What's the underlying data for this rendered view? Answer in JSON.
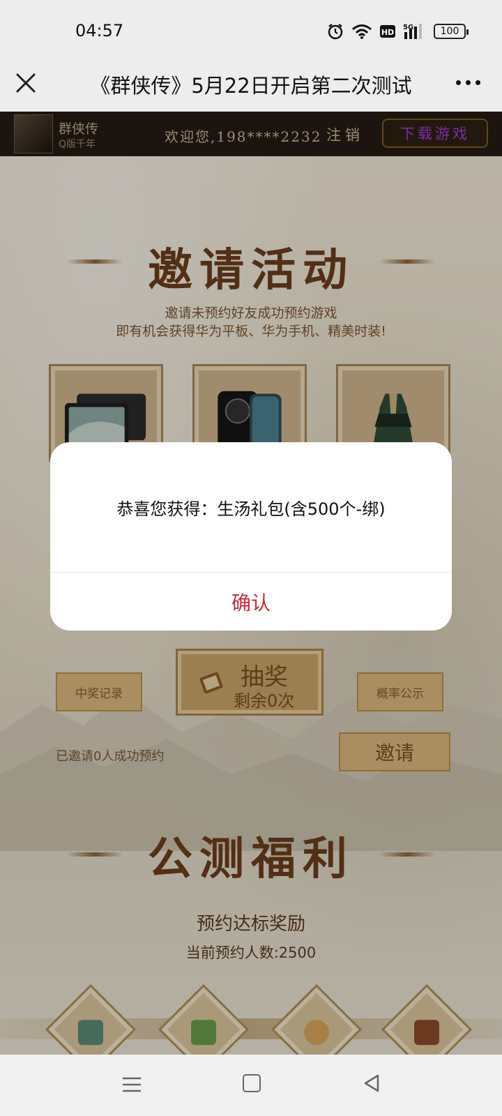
{
  "status_bar": {
    "time": "04:57",
    "network": "5G",
    "hd": "HD",
    "battery": "100"
  },
  "title_bar": {
    "title": "《群侠传》5月22日开启第二次测试"
  },
  "page": {
    "header": {
      "game_name": "群侠传",
      "game_sub": "Q版千年",
      "welcome": "欢迎您,198****2232",
      "logout": "注销",
      "download": "下载游戏"
    },
    "invite_section": {
      "title": "邀请活动",
      "desc_line1": "邀请未预约好友成功预约游戏",
      "desc_line2": "即有机会获得华为平板、华为手机、精美时装!",
      "prizes": [
        "tablet",
        "phone",
        "costume"
      ]
    },
    "lottery": {
      "records": "中奖记录",
      "title": "抽奖",
      "remaining": "剩余0次",
      "probability": "概率公示"
    },
    "invited_text": "已邀请0人成功预约",
    "invite_button": "邀请",
    "welfare_section": {
      "title": "公测福利",
      "reward_title": "预约达标奖励",
      "reward_count": "当前预约人数:2500"
    }
  },
  "dialog": {
    "message": "恭喜您获得：生汤礼包(含500个-绑)",
    "confirm": "确认"
  },
  "colors": {
    "confirm": "#c8283a",
    "accent_brown": "#6b3d1c"
  }
}
